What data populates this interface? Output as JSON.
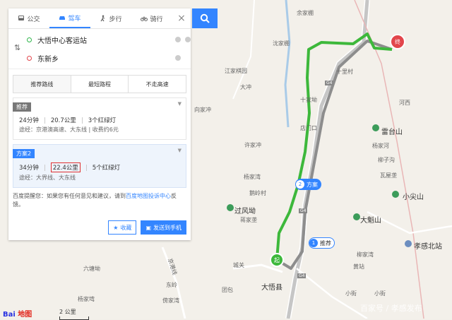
{
  "modes": [
    {
      "label": "公交",
      "icon": "bus-icon"
    },
    {
      "label": "驾车",
      "icon": "car-icon"
    },
    {
      "label": "步行",
      "icon": "walk-icon"
    },
    {
      "label": "骑行",
      "icon": "bike-icon"
    }
  ],
  "active_mode": "驾车",
  "origin": "大悟中心客运站",
  "destination": "东新乡",
  "strategies": [
    "推荐路线",
    "最短路程",
    "不走高速"
  ],
  "plans": [
    {
      "tag": "推荐",
      "time": "24分钟",
      "distance": "20.7公里",
      "lights": "3个红绿灯",
      "via": "途经：京港澳高速、大东线",
      "fee": "收费约6元"
    },
    {
      "tag": "方案2",
      "time": "34分钟",
      "distance": "22.4公里",
      "lights": "5个红绿灯",
      "via": "途经：大界线、大东线"
    }
  ],
  "tip": {
    "text": "百度提醒您：如果您有任何意见和建议，请到",
    "link": "百度地图投诉中心",
    "suffix": "反馈。"
  },
  "buttons": {
    "favorite": "收藏",
    "send": "发送到手机"
  },
  "map_labels": {
    "towns": [
      "大悟县",
      "沈家棚",
      "杨家河",
      "小尖山",
      "大魁山",
      "雷台山",
      "过风坳",
      "孝感北站",
      "大冲",
      "十家坳",
      "余家棚",
      "河西"
    ],
    "small": [
      "江家棋园",
      "向家冲",
      "许家冲",
      "十里村",
      "店门口",
      "杨家湾",
      "鹅岭村",
      "蒋家垄",
      "柳子沟",
      "瓦屋垄",
      "傍家湾",
      "六塘坳",
      "杨家塆",
      "团包",
      "小街",
      "小街",
      "城关",
      "黄站",
      "柳家湾",
      "东岭"
    ]
  },
  "road_labels": [
    "G4",
    "G4",
    "G4",
    "京港线"
  ],
  "route_tags": {
    "alt": "方案",
    "main": "推荐",
    "alt_num": "2",
    "main_num": "1"
  },
  "markers": {
    "start": "起",
    "end": "终"
  },
  "logo": {
    "bai": "Bai",
    "du": "地图"
  },
  "scale": "2 公里",
  "watermark": "百家号 / 孝感发布",
  "colors": {
    "route_main": "#9a9a9a",
    "route_alt": "#3db83b",
    "accent": "#3385ff",
    "highlight": "#e03030"
  }
}
